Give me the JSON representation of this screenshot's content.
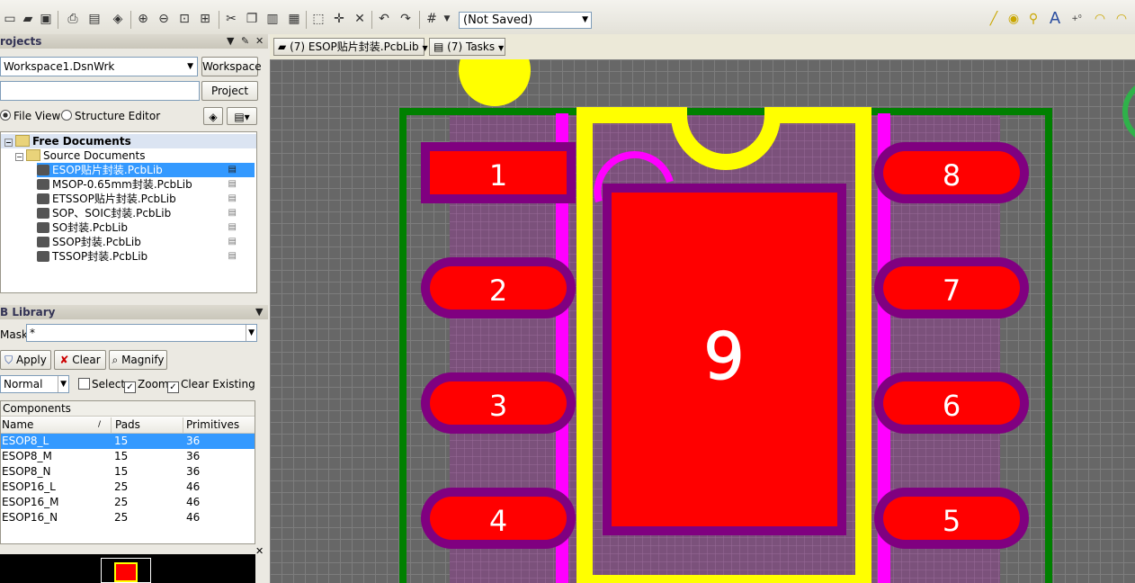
{
  "toolbar": {
    "status_combo": "(Not Saved)"
  },
  "projects_panel": {
    "title": "rojects",
    "workspace_value": "Workspace1.DsnWrk",
    "workspace_button": "Workspace",
    "project_button": "Project",
    "file_view_label": "File View",
    "structure_editor_label": "Structure Editor"
  },
  "tree": {
    "root": "Free Documents",
    "source_folder": "Source Documents",
    "items": [
      "ESOP贴片封装.PcbLib",
      "MSOP-0.65mm封装.PcbLib",
      "ETSSOP贴片封装.PcbLib",
      "SOP、SOIC封装.PcbLib",
      "SO封装.PcbLib",
      "SSOP封装.PcbLib",
      "TSSOP封装.PcbLib"
    ]
  },
  "library_panel": {
    "title": "B Library",
    "mask_label": "Mask",
    "mask_value": "*",
    "apply_button": "Apply",
    "clear_button": "Clear",
    "magnify_button": "Magnify",
    "mode_value": "Normal",
    "select_label": "Select",
    "zoom_label": "Zoom",
    "clear_existing_label": "Clear Existing",
    "components_header": "Components",
    "columns": [
      "Name",
      "Pads",
      "Primitives"
    ],
    "rows": [
      [
        "ESOP8_L",
        "15",
        "36"
      ],
      [
        "ESOP8_M",
        "15",
        "36"
      ],
      [
        "ESOP8_N",
        "15",
        "36"
      ],
      [
        "ESOP16_L",
        "25",
        "46"
      ],
      [
        "ESOP16_M",
        "25",
        "46"
      ],
      [
        "ESOP16_N",
        "25",
        "46"
      ]
    ]
  },
  "tabs": {
    "doc_tab": "(7) ESOP贴片封装.PcbLib",
    "tasks_tab": "(7) Tasks"
  },
  "pcb": {
    "pads_left": [
      "1",
      "2",
      "3",
      "4"
    ],
    "pads_right": [
      "8",
      "7",
      "6",
      "5"
    ],
    "center_pad": "9"
  },
  "colors": {
    "pad": "#ff0000",
    "pad_mask": "#800080",
    "silk": "#ffff00",
    "board": "#008000",
    "keepout": "#ff00ff"
  }
}
